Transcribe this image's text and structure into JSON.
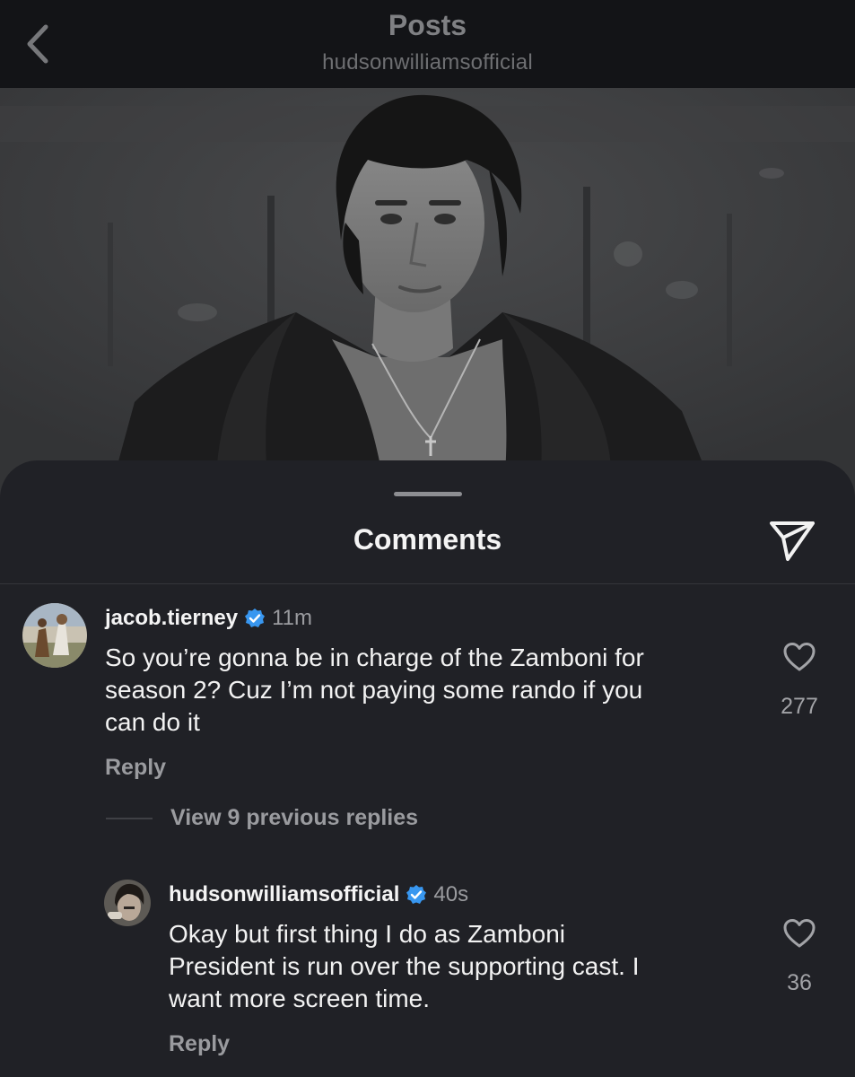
{
  "header": {
    "title": "Posts",
    "subtitle": "hudsonwilliamsofficial",
    "back_icon": "chevron-left-icon"
  },
  "sheet": {
    "title": "Comments",
    "share_icon": "send-icon"
  },
  "comments": [
    {
      "username": "jacob.tierney",
      "verified": true,
      "time": "11m",
      "lines": [
        "So you’re gonna be in charge of the Zamboni for",
        "season 2? Cuz I’m not paying some rando if you",
        "can do it"
      ],
      "reply_label": "Reply",
      "likes": "277"
    }
  ],
  "view_replies": "View 9 previous replies",
  "replies": [
    {
      "username": "hudsonwilliamsofficial",
      "verified": true,
      "time": "40s",
      "lines": [
        "Okay but first thing I do as Zamboni",
        "President is run over the supporting cast. I",
        "want more screen time."
      ],
      "reply_label": "Reply",
      "likes": "36"
    }
  ],
  "colors": {
    "background": "#16171a",
    "sheet": "#202126",
    "verified_badge": "#3897f0",
    "secondary_text": "#9a9b9f"
  }
}
